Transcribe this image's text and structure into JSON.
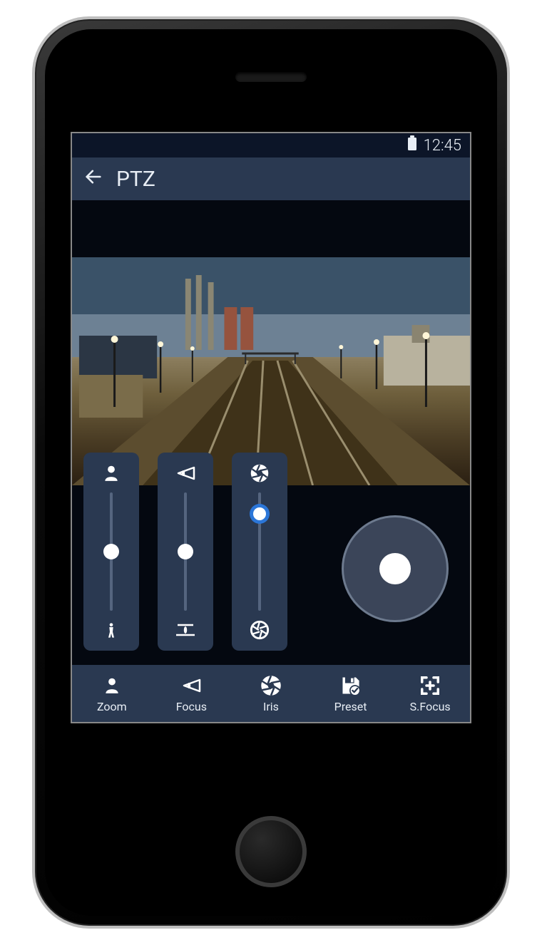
{
  "status": {
    "time": "12:45",
    "battery_icon": "battery-full"
  },
  "header": {
    "title": "PTZ",
    "back_icon": "arrow-left"
  },
  "sliders": {
    "zoom": {
      "position_pct": 50,
      "top_icon": "person-large",
      "bottom_icon": "person-small"
    },
    "focus": {
      "position_pct": 50,
      "top_icon": "focus-far",
      "bottom_icon": "focus-near"
    },
    "iris": {
      "position_pct": 18,
      "active": true,
      "top_icon": "aperture-open",
      "bottom_icon": "aperture-closed"
    }
  },
  "joystick": {
    "label": "ptz-joystick"
  },
  "tabs": [
    {
      "key": "zoom",
      "label": "Zoom",
      "icon": "person"
    },
    {
      "key": "focus",
      "label": "Focus",
      "icon": "focus"
    },
    {
      "key": "iris",
      "label": "Iris",
      "icon": "aperture"
    },
    {
      "key": "preset",
      "label": "Preset",
      "icon": "save-check"
    },
    {
      "key": "sfocus",
      "label": "S.Focus",
      "icon": "autofocus-target"
    }
  ],
  "colors": {
    "panel": "#2a3951",
    "bg": "#0c1528",
    "accent": "#2b76d8",
    "fg": "#e8eef5"
  }
}
